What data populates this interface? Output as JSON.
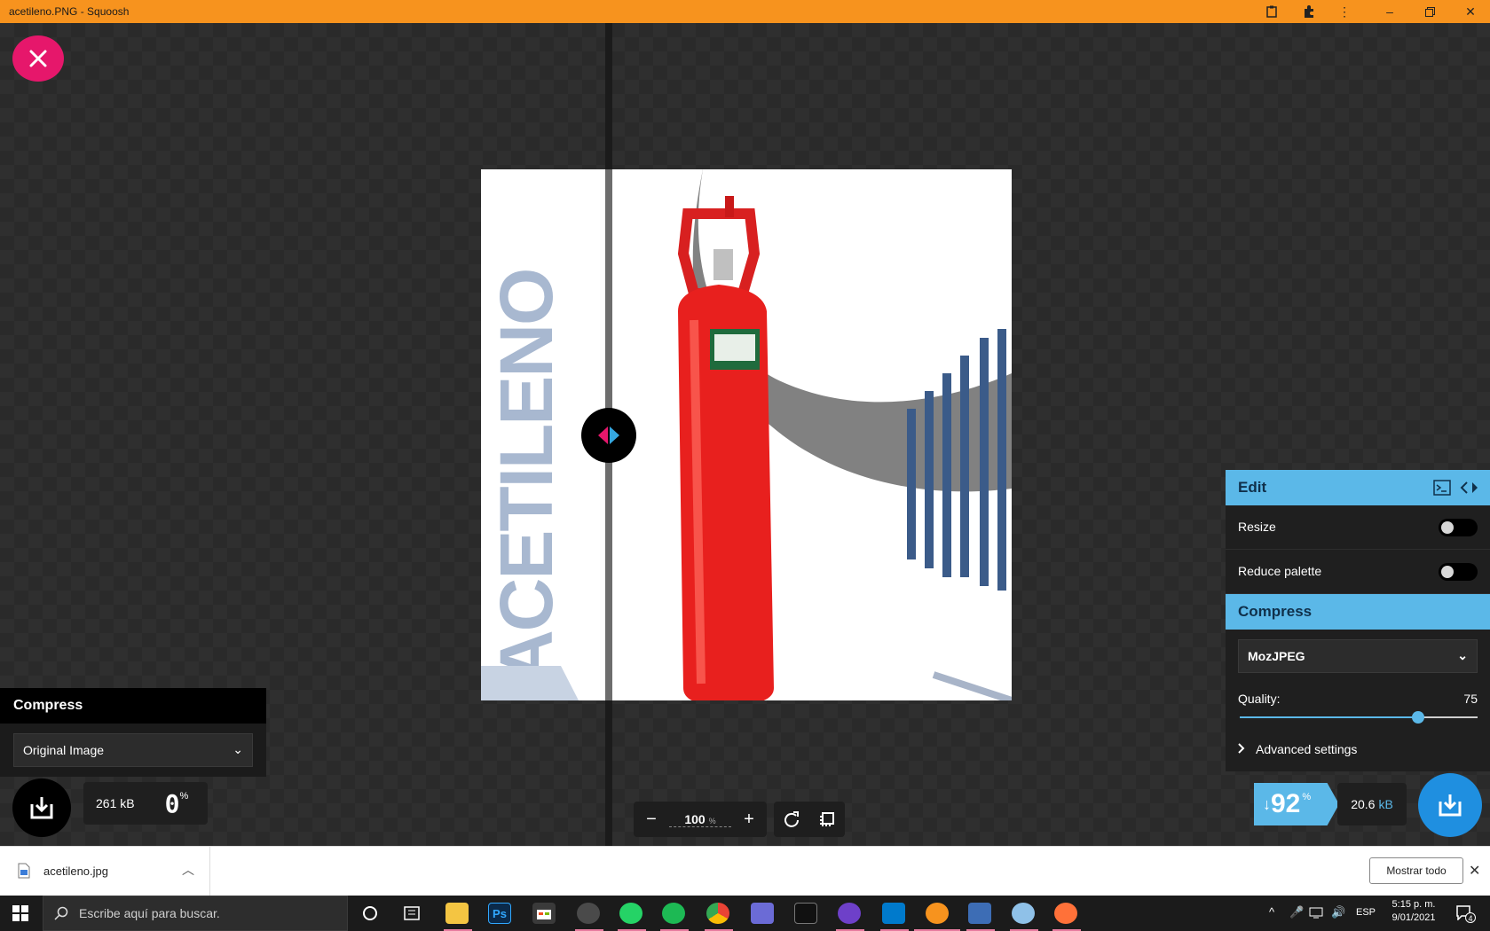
{
  "window": {
    "title": "acetileno.PNG - Squoosh",
    "controls": [
      "clipboard-icon",
      "extensions-icon",
      "more-icon",
      "minimize-icon",
      "restore-icon",
      "close-icon"
    ]
  },
  "image": {
    "vertical_text": "ACETILENO"
  },
  "left_panel": {
    "heading": "Compress",
    "codec": "Original Image",
    "size": "261 kB",
    "percent": "0",
    "percent_unit": "%"
  },
  "right_panel": {
    "edit_heading": "Edit",
    "resize_label": "Resize",
    "resize_on": false,
    "reduce_palette_label": "Reduce palette",
    "reduce_palette_on": false,
    "compress_heading": "Compress",
    "codec": "MozJPEG",
    "quality_label": "Quality:",
    "quality_value": "75",
    "quality_fraction": 0.75,
    "advanced_label": "Advanced settings",
    "savings_arrow": "↓",
    "savings_value": "92",
    "savings_unit": "%",
    "output_size_value": "20.6",
    "output_size_unit": "kB"
  },
  "zoom": {
    "value": "100",
    "unit": "%"
  },
  "downloads": {
    "file_name": "acetileno.jpg",
    "show_all": "Mostrar todo"
  },
  "taskbar": {
    "search_placeholder": "Escribe aquí para buscar.",
    "lang": "ESP",
    "time": "5:15 p. m.",
    "date": "9/01/2021",
    "notifications": "4"
  },
  "colors": {
    "titlebar": "#f7931e",
    "accent_blue": "#5bb8e8",
    "close_pink": "#e6176b"
  }
}
